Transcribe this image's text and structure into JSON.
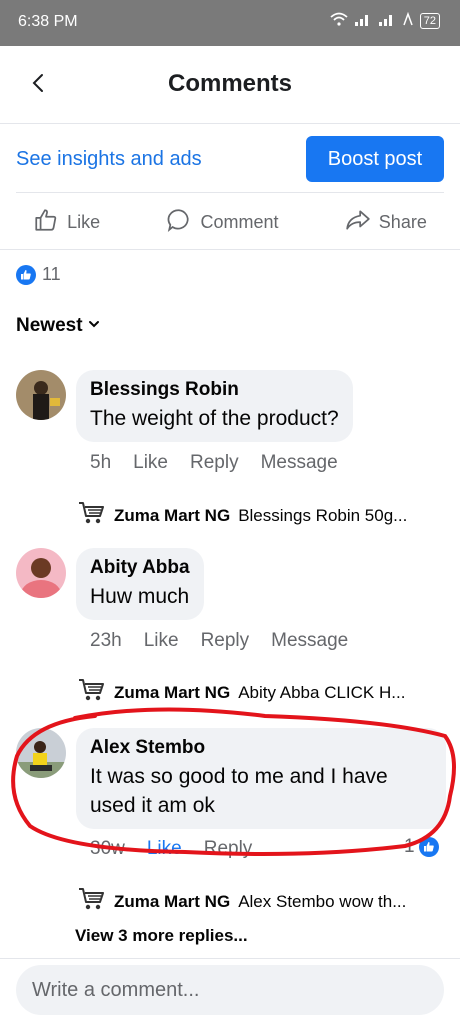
{
  "status_bar": {
    "time": "6:38 PM",
    "battery": "72"
  },
  "header": {
    "title": "Comments"
  },
  "promo": {
    "insights_label": "See insights and ads",
    "boost_label": "Boost post"
  },
  "actions": {
    "like": "Like",
    "comment": "Comment",
    "share": "Share"
  },
  "reactions": {
    "count": "11"
  },
  "sort": {
    "label": "Newest"
  },
  "comments": [
    {
      "name": "Blessings Robin",
      "text": "The weight of the product?",
      "time": "5h",
      "like": "Like",
      "reply": "Reply",
      "message": "Message",
      "reply_preview": {
        "author": "Zuma Mart NG",
        "text": "Blessings Robin 50g..."
      }
    },
    {
      "name": "Abity Abba",
      "text": "Huw much",
      "time": "23h",
      "like": "Like",
      "reply": "Reply",
      "message": "Message",
      "reply_preview": {
        "author": "Zuma Mart NG",
        "text": "Abity Abba CLICK H..."
      }
    },
    {
      "name": "Alex Stembo",
      "text_line1": "It was so good to me and  I have",
      "text_line2": "used it am ok",
      "time": "30w",
      "like": "Like",
      "reply": "Reply",
      "reaction_count": "1",
      "reply_preview": {
        "author": "Zuma Mart NG",
        "text": "Alex Stembo wow th..."
      }
    }
  ],
  "more_replies": "View 3 more replies...",
  "composer": {
    "placeholder": "Write a comment..."
  },
  "colors": {
    "accent": "#1877f2",
    "annotation": "#e3141b"
  }
}
